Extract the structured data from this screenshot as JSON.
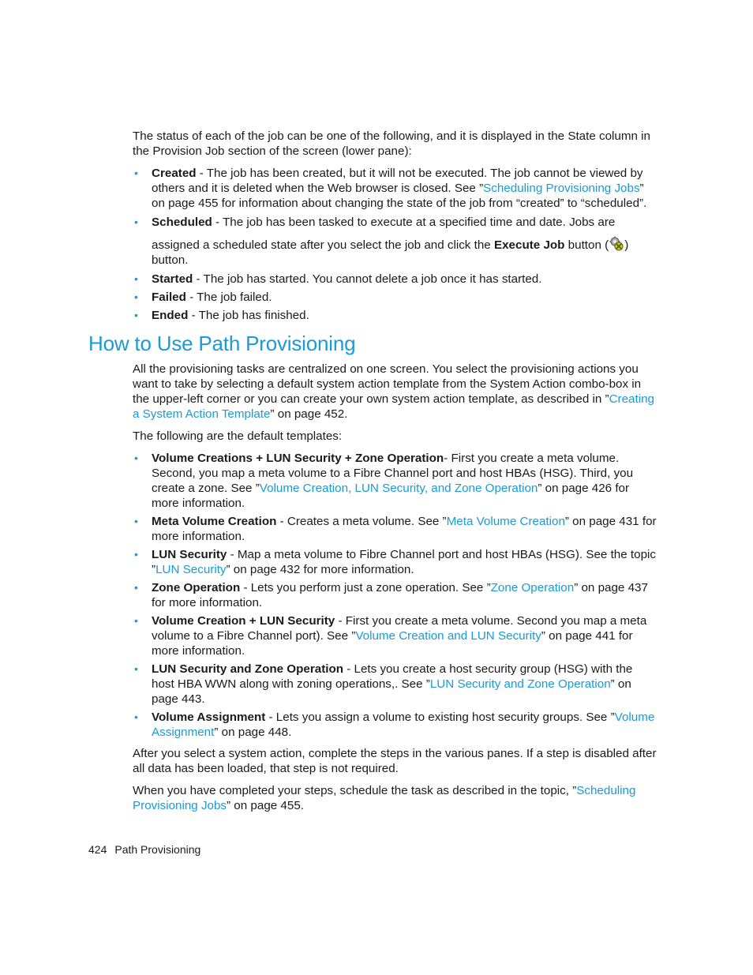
{
  "status_section": {
    "intro": "The status of each of the job can be one of the following, and it is displayed in the State column in the Provision Job section of the screen (lower pane):",
    "items": [
      {
        "term": "Created",
        "text_before": " - The job has been created, but it will not be executed. The job cannot be viewed by others and it is deleted when the Web browser is closed. See ”",
        "link": "Scheduling Provisioning Jobs",
        "text_after": "” on page 455 for information about changing the state of the job from “created” to “scheduled”."
      },
      {
        "term": "Scheduled",
        "text_line1": " - The job has been tasked to execute at a specified time and date. Jobs are",
        "text_line2_before": "assigned a scheduled state after you select the job and click the ",
        "button_name": "Execute Job",
        "text_line2_mid": " button (",
        "icon": "execute-job-gear-icon",
        "text_line2_after": ") button."
      },
      {
        "term": "Started",
        "text": " - The job has started. You cannot delete a job once it has started."
      },
      {
        "term": "Failed",
        "text": " - The job failed."
      },
      {
        "term": "Ended",
        "text": " - The job has finished."
      }
    ]
  },
  "section": {
    "title": "How to Use Path Provisioning",
    "intro_before": "All the provisioning tasks are centralized on one screen. You select the provisioning actions you want to take by selecting a default system action template from the System Action combo-box in the upper-left corner or you can create your own system action template, as described in ”",
    "intro_link": "Creating a System Action Template",
    "intro_after": "” on page 452.",
    "templates_lead": "The following are the default templates:",
    "templates": [
      {
        "term": "Volume Creations + LUN Security + Zone Operation",
        "text_before": "- First you create a meta volume. Second, you map a meta volume to a Fibre Channel port and host HBAs (HSG). Third, you create a zone. See ”",
        "link": "Volume Creation, LUN Security, and Zone Operation",
        "text_after": "” on page 426 for more information."
      },
      {
        "term": "Meta Volume Creation",
        "text_before": " - Creates a meta volume. See ”",
        "link": "Meta Volume Creation",
        "text_after": "” on page 431 for more information."
      },
      {
        "term": "LUN Security",
        "text_before": " - Map a meta volume to Fibre Channel port and host HBAs (HSG). See the topic ”",
        "link": "LUN Security",
        "text_after": "” on page 432 for more information."
      },
      {
        "term": "Zone Operation",
        "text_before": " - Lets you perform just a zone operation. See ”",
        "link": "Zone Operation",
        "text_after": "” on page 437 for more information."
      },
      {
        "term": "Volume Creation + LUN Security",
        "text_before": " - First you create a meta volume. Second you map a meta volume to a Fibre Channel port). See ”",
        "link": "Volume Creation and LUN Security",
        "text_after": "” on page 441 for more information."
      },
      {
        "term": "LUN Security and Zone Operation",
        "text_before": " - Lets you create a host security group (HSG) with the host HBA WWN along with zoning operations,. See ”",
        "link": "LUN Security and Zone Operation",
        "text_after": "” on page 443."
      },
      {
        "term": "Volume Assignment",
        "text_before": " - Lets you assign a volume to existing host security groups. See ”",
        "link": "Volume Assignment",
        "text_after": "” on page 448."
      }
    ],
    "after_select": "After you select a system action, complete the steps in the various panes. If a step is disabled after all data has been loaded, that step is not required.",
    "completed_before": "When you have completed your steps, schedule the task as described in the topic, ”",
    "completed_link": "Scheduling Provisioning Jobs",
    "completed_after": "” on page 455."
  },
  "footer": {
    "page_number": "424",
    "chapter": "Path Provisioning"
  },
  "colors": {
    "link": "#1a9ad6",
    "heading": "#1a9ad6",
    "text": "#1a1a1a"
  }
}
